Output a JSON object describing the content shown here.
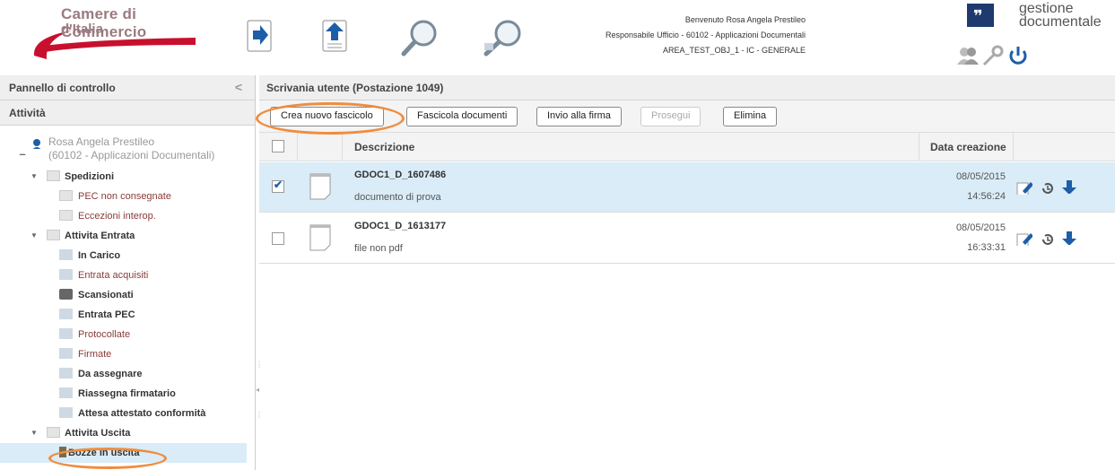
{
  "header": {
    "logo": {
      "line1": "Camere di Commercio",
      "line2": "d'Italia"
    },
    "toolbar_icons": [
      "arrow-right-doc-icon",
      "arrow-up-doc-icon",
      "search-icon",
      "advanced-search-icon"
    ],
    "user": {
      "welcome": "Benvenuto Rosa Angela Prestileo",
      "role": "Responsabile Ufficio - 60102 - Applicazioni Documentali",
      "area": "AREA_TEST_OBJ_1 - IC - GENERALE"
    },
    "brand": {
      "line1": "gestione",
      "line2": "documentale"
    },
    "right_icons": [
      "users-icon",
      "key-icon",
      "power-icon"
    ]
  },
  "left_panel": {
    "title": "Pannello di controllo",
    "collapse": "<",
    "section": "Attività",
    "user_node": {
      "name": "Rosa Angela Prestileo",
      "office": "(60102 - Applicazioni Documentali)"
    },
    "tree": [
      {
        "label": "Spedizioni",
        "level": 1,
        "bold": true
      },
      {
        "label": "PEC non consegnate",
        "level": 2
      },
      {
        "label": "Eccezioni interop.",
        "level": 2
      },
      {
        "label": "Attivita Entrata",
        "level": 1,
        "bold": true
      },
      {
        "label": "In Carico",
        "level": 2,
        "bold": true
      },
      {
        "label": "Entrata acquisiti",
        "level": 2
      },
      {
        "label": "Scansionati",
        "level": 2,
        "bold": true
      },
      {
        "label": "Entrata PEC",
        "level": 2,
        "bold": true
      },
      {
        "label": "Protocollate",
        "level": 2
      },
      {
        "label": "Firmate",
        "level": 2
      },
      {
        "label": "Da assegnare",
        "level": 2,
        "bold": true
      },
      {
        "label": "Riassegna firmatario",
        "level": 2,
        "bold": true
      },
      {
        "label": "Attesa attestato conformità",
        "level": 2,
        "bold": true
      },
      {
        "label": "Attivita Uscita",
        "level": 1,
        "bold": true
      },
      {
        "label": "Bozze in uscita",
        "level": 2,
        "bold": true,
        "selected": true
      }
    ]
  },
  "main": {
    "title": "Scrivania utente (Postazione 1049)",
    "buttons": {
      "new_folder": "Crea nuovo fascicolo",
      "file_docs": "Fascicola documenti",
      "send_sign": "Invio alla firma",
      "continue": "Prosegui",
      "delete": "Elimina"
    },
    "columns": {
      "description": "Descrizione",
      "created": "Data creazione"
    },
    "rows": [
      {
        "id": "GDOC1_D_1607486",
        "desc": "documento di prova",
        "date": "08/05/2015",
        "time": "14:56:24",
        "checked": true
      },
      {
        "id": "GDOC1_D_1613177",
        "desc": "file non pdf",
        "date": "08/05/2015",
        "time": "16:33:31",
        "checked": false
      }
    ]
  },
  "colors": {
    "highlight": "#d9ecf7",
    "annotation": "#f08c3e",
    "brand_red": "#c8102e",
    "action_blue": "#1d5ea8"
  }
}
